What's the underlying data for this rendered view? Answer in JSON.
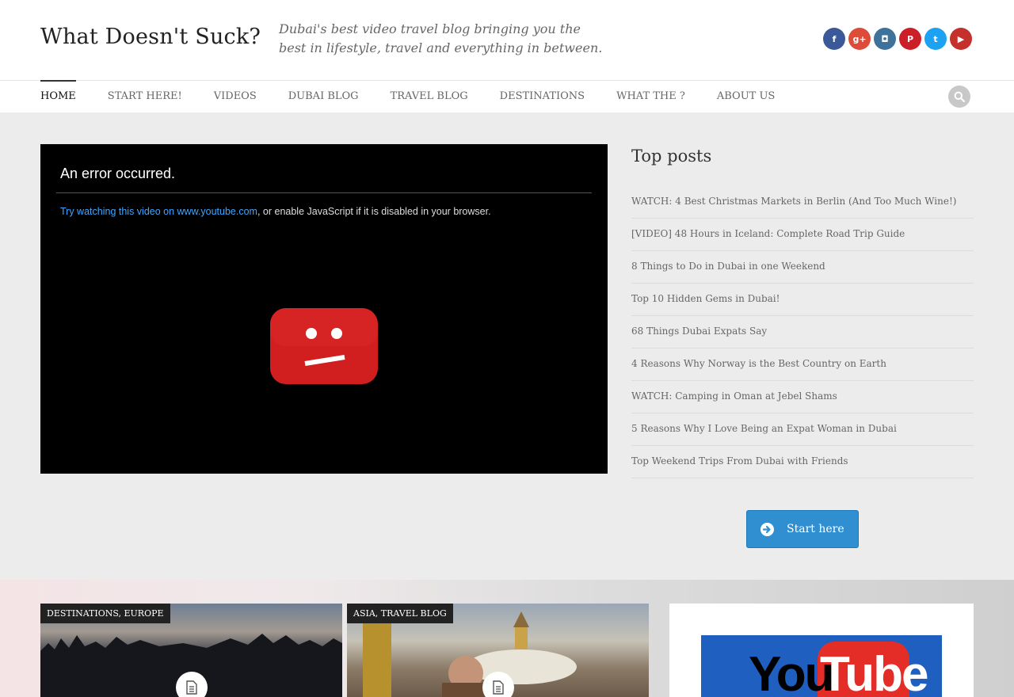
{
  "site": {
    "title": "What Doesn't Suck?",
    "tagline": "Dubai's best video travel blog bringing you the best in lifestyle, travel and everything in between."
  },
  "social": [
    {
      "name": "facebook",
      "glyph": "f",
      "color": "#3b5998"
    },
    {
      "name": "google-plus",
      "glyph": "g+",
      "color": "#dd4b39"
    },
    {
      "name": "instagram",
      "glyph": "◘",
      "color": "#3f729b"
    },
    {
      "name": "pinterest",
      "glyph": "P",
      "color": "#cb2027"
    },
    {
      "name": "twitter",
      "glyph": "t",
      "color": "#1da1f2"
    },
    {
      "name": "youtube",
      "glyph": "▶",
      "color": "#c4302b"
    }
  ],
  "nav": {
    "items": [
      "HOME",
      "START HERE!",
      "VIDEOS",
      "DUBAI BLOG",
      "TRAVEL BLOG",
      "DESTINATIONS",
      "WHAT THE ?",
      "ABOUT US"
    ],
    "active": "HOME"
  },
  "video": {
    "error_title": "An error occurred.",
    "link_text": "Try watching this video on www.youtube.com",
    "message_rest": ", or enable JavaScript if it is disabled in your browser."
  },
  "sidebar": {
    "title": "Top posts",
    "posts": [
      "WATCH: 4 Best Christmas Markets in Berlin (And Too Much Wine!)",
      "[VIDEO] 48 Hours in Iceland: Complete Road Trip Guide",
      "8 Things to Do in Dubai in one Weekend",
      "Top 10 Hidden Gems in Dubai!",
      "68 Things Dubai Expats Say",
      "4 Reasons Why Norway is the Best Country on Earth",
      "WATCH: Camping in Oman at Jebel Shams",
      "5 Reasons Why I Love Being an Expat Woman in Dubai",
      "Top Weekend Trips From Dubai with Friends"
    ],
    "start_button": "Start here"
  },
  "cards": [
    {
      "categories": "DESTINATIONS, EUROPE"
    },
    {
      "categories": "ASIA, TRAVEL BLOG"
    }
  ],
  "youtube_widget": {
    "you": "You",
    "tube": "Tube"
  },
  "colors": {
    "accent": "#2f8fd0",
    "youtube_red": "#e52d27"
  }
}
